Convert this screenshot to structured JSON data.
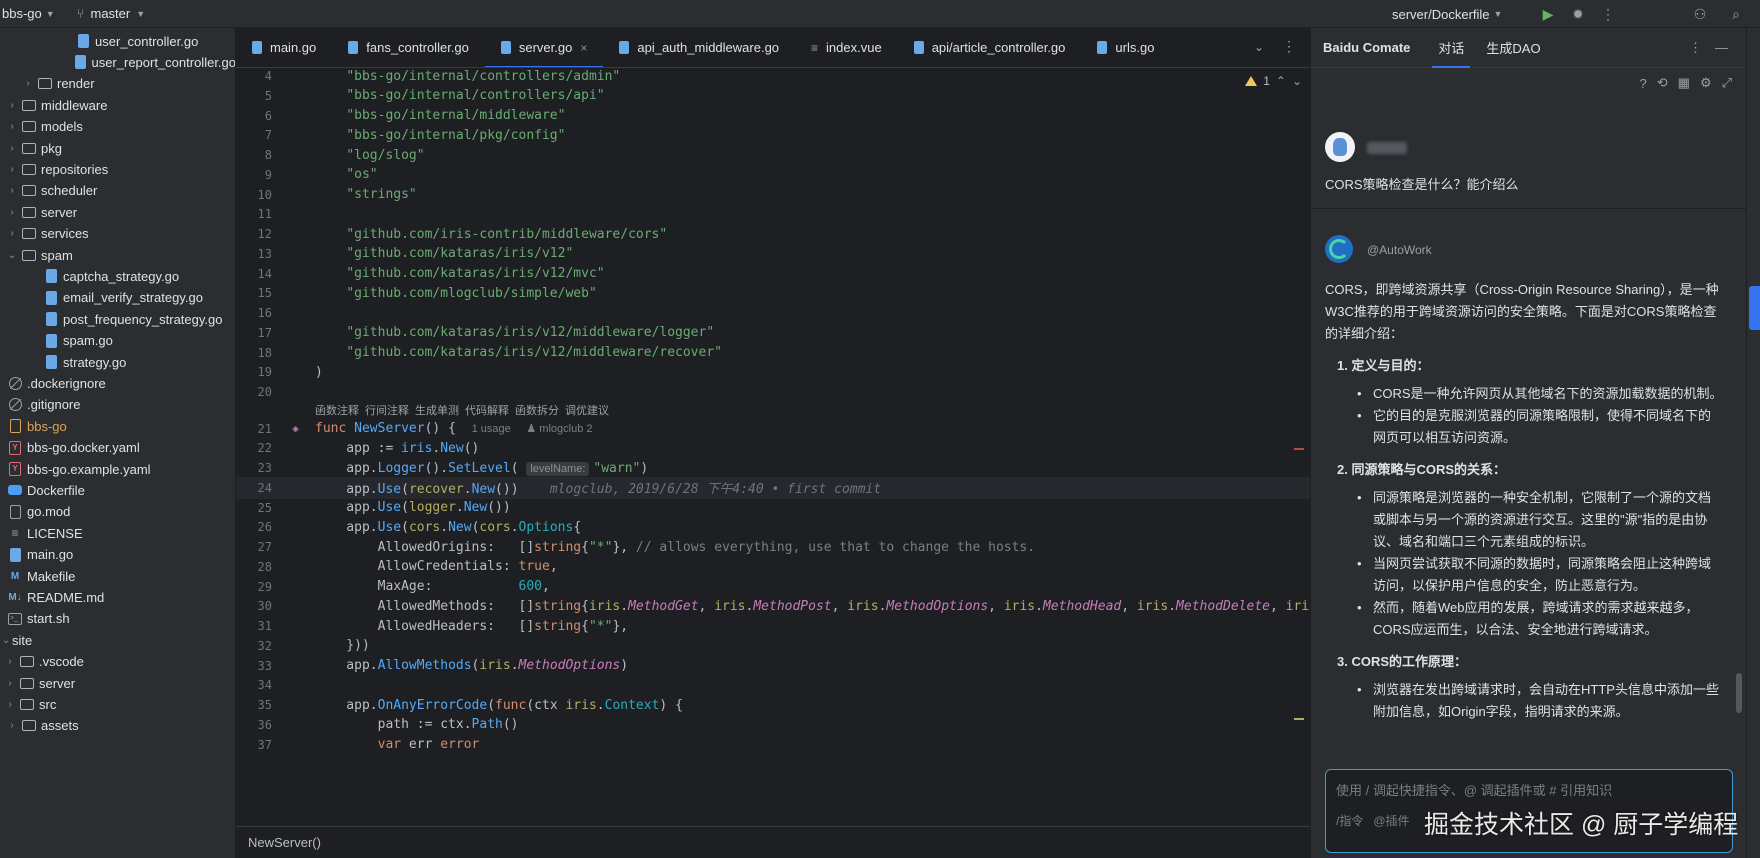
{
  "titlebar": {
    "project": "bbs-go",
    "branch": "master",
    "run_config": "server/Dockerfile"
  },
  "sidebar": {
    "items": [
      {
        "label": "user_controller.go",
        "kind": "go",
        "indent": 3
      },
      {
        "label": "user_report_controller.go",
        "kind": "go",
        "indent": 3
      },
      {
        "label": "render",
        "kind": "folder",
        "indent": 1
      },
      {
        "label": "middleware",
        "kind": "folder",
        "indent": 0
      },
      {
        "label": "models",
        "kind": "folder",
        "indent": 0
      },
      {
        "label": "pkg",
        "kind": "folder",
        "indent": 0
      },
      {
        "label": "repositories",
        "kind": "folder",
        "indent": 0
      },
      {
        "label": "scheduler",
        "kind": "folder",
        "indent": 0
      },
      {
        "label": "server",
        "kind": "folder",
        "indent": 0
      },
      {
        "label": "services",
        "kind": "folder",
        "indent": 0
      },
      {
        "label": "spam",
        "kind": "folder-open",
        "indent": 0
      },
      {
        "label": "captcha_strategy.go",
        "kind": "go",
        "indent": 2
      },
      {
        "label": "email_verify_strategy.go",
        "kind": "go",
        "indent": 2
      },
      {
        "label": "post_frequency_strategy.go",
        "kind": "go",
        "indent": 2
      },
      {
        "label": "spam.go",
        "kind": "go",
        "indent": 2
      },
      {
        "label": "strategy.go",
        "kind": "go",
        "indent": 2
      },
      {
        "label": ".dockerignore",
        "kind": "ignore",
        "indent": -1
      },
      {
        "label": ".gitignore",
        "kind": "ignore",
        "indent": -1
      },
      {
        "label": "bbs-go",
        "kind": "plain-orange",
        "indent": -1
      },
      {
        "label": "bbs-go.docker.yaml",
        "kind": "yaml",
        "indent": -1
      },
      {
        "label": "bbs-go.example.yaml",
        "kind": "yaml",
        "indent": -1
      },
      {
        "label": "Dockerfile",
        "kind": "docker",
        "indent": -1
      },
      {
        "label": "go.mod",
        "kind": "plain",
        "indent": -1
      },
      {
        "label": "LICENSE",
        "kind": "license",
        "indent": -1
      },
      {
        "label": "main.go",
        "kind": "go",
        "indent": -1
      },
      {
        "label": "Makefile",
        "kind": "make",
        "indent": -1
      },
      {
        "label": "README.md",
        "kind": "md",
        "indent": -1
      },
      {
        "label": "start.sh",
        "kind": "term",
        "indent": -1
      },
      {
        "label": "site",
        "kind": "root",
        "indent": -2
      },
      {
        "label": ".vscode",
        "kind": "folder",
        "indent": -1
      },
      {
        "label": "server",
        "kind": "folder",
        "indent": -1
      },
      {
        "label": "src",
        "kind": "folder",
        "indent": -1
      },
      {
        "label": "assets",
        "kind": "folder",
        "indent": 0
      }
    ]
  },
  "tabs": [
    {
      "label": "main.go",
      "active": false
    },
    {
      "label": "fans_controller.go",
      "active": false
    },
    {
      "label": "server.go",
      "active": true
    },
    {
      "label": "api_auth_middleware.go",
      "active": false
    },
    {
      "label": "index.vue",
      "active": false
    },
    {
      "label": "api/article_controller.go",
      "active": false
    },
    {
      "label": "urls.go",
      "active": false
    }
  ],
  "editor": {
    "warnings_count": "1",
    "codelens": [
      "函数注释",
      "行间注释",
      "生成单测",
      "代码解释",
      "函数拆分",
      "调优建议"
    ],
    "usage_hint": "1 usage",
    "author_hint": "mlogclub 2",
    "param_hint": "levelName:",
    "blame": "mlogclub, 2019/6/28 下午4:40 • first commit",
    "lines": [
      {
        "no": "4",
        "code": "    \"bbs-go/internal/controllers/admin\""
      },
      {
        "no": "5",
        "code": "    \"bbs-go/internal/controllers/api\""
      },
      {
        "no": "6",
        "code": "    \"bbs-go/internal/middleware\""
      },
      {
        "no": "7",
        "code": "    \"bbs-go/internal/pkg/config\""
      },
      {
        "no": "8",
        "code": "    \"log/slog\""
      },
      {
        "no": "9",
        "code": "    \"os\""
      },
      {
        "no": "10",
        "code": "    \"strings\""
      },
      {
        "no": "11",
        "code": ""
      },
      {
        "no": "12",
        "code": "    \"github.com/iris-contrib/middleware/cors\""
      },
      {
        "no": "13",
        "code": "    \"github.com/kataras/iris/v12\""
      },
      {
        "no": "14",
        "code": "    \"github.com/kataras/iris/v12/mvc\""
      },
      {
        "no": "15",
        "code": "    \"github.com/mlogclub/simple/web\""
      },
      {
        "no": "16",
        "code": ""
      },
      {
        "no": "17",
        "code": "    \"github.com/kataras/iris/v12/middleware/logger\""
      },
      {
        "no": "18",
        "code": "    \"github.com/kataras/iris/v12/middleware/recover\""
      },
      {
        "no": "19",
        "code": ")"
      },
      {
        "no": "20",
        "code": ""
      }
    ],
    "func_line_no": "21",
    "func_sig": "NewServer",
    "body_lines": [
      {
        "no": "22",
        "code": "app := iris.New()"
      },
      {
        "no": "23",
        "code": "app.Logger().SetLevel( \"warn\")"
      },
      {
        "no": "24",
        "code": "app.Use(recover.New())"
      },
      {
        "no": "25",
        "code": "app.Use(logger.New())"
      },
      {
        "no": "26",
        "code": "app.Use(cors.New(cors.Options{"
      },
      {
        "no": "27",
        "code": "AllowedOrigins:   []string{\"*\"}, // allows everything, use that to change the hosts."
      },
      {
        "no": "28",
        "code": "AllowCredentials: true,"
      },
      {
        "no": "29",
        "code": "MaxAge:           600,"
      },
      {
        "no": "30",
        "code": "AllowedMethods:   []string{iris.MethodGet, iris.MethodPost, iris.MethodOptions, iris.MethodHead, iris.MethodDelete, iris"
      },
      {
        "no": "31",
        "code": "AllowedHeaders:   []string{\"*\"},"
      },
      {
        "no": "32",
        "code": "}))"
      },
      {
        "no": "33",
        "code": "app.AllowMethods(iris.MethodOptions)"
      },
      {
        "no": "34",
        "code": ""
      },
      {
        "no": "35",
        "code": "app.OnAnyErrorCode(func(ctx iris.Context) {"
      },
      {
        "no": "36",
        "code": "path := ctx.Path()"
      },
      {
        "no": "37",
        "code": "var err error"
      }
    ]
  },
  "statusbar": {
    "breadcrumb": "NewServer()"
  },
  "chat": {
    "title": "Baidu Comate",
    "tabs": [
      "对话",
      "生成DAO"
    ],
    "question": "CORS策略检查是什么？能介绍么",
    "bot_name": "@AutoWork",
    "intro": "CORS，即跨域资源共享（Cross-Origin Resource Sharing），是一种W3C推荐的用于跨域资源访问的安全策略。下面是对CORS策略检查的详细介绍：",
    "sections": [
      {
        "heading": "1. 定义与目的：",
        "bullets": [
          "CORS是一种允许网页从其他域名下的资源加载数据的机制。",
          "它的目的是克服浏览器的同源策略限制，使得不同域名下的网页可以相互访问资源。"
        ]
      },
      {
        "heading": "2. 同源策略与CORS的关系：",
        "bullets": [
          "同源策略是浏览器的一种安全机制，它限制了一个源的文档或脚本与另一个源的资源进行交互。这里的\"源\"指的是由协议、域名和端口三个元素组成的标识。",
          "当网页尝试获取不同源的数据时，同源策略会阻止这种跨域访问，以保护用户信息的安全，防止恶意行为。",
          "然而，随着Web应用的发展，跨域请求的需求越来越多，CORS应运而生，以合法、安全地进行跨域请求。"
        ]
      },
      {
        "heading": "3. CORS的工作原理：",
        "bullets": [
          "浏览器在发出跨域请求时，会自动在HTTP头信息中添加一些附加信息，如Origin字段，指明请求的来源。"
        ]
      }
    ],
    "input_placeholder": "使用 / 调起快捷指令、@ 调起插件或 # 引用知识",
    "chips": [
      "/指令",
      "@插件"
    ]
  },
  "watermark": "掘金技术社区 @ 厨子学编程",
  "colors": {
    "accent": "#3574f0",
    "bg": "#1e1f22",
    "panel": "#2b2d30",
    "string": "#6aab73",
    "keyword": "#cf8e6d"
  }
}
